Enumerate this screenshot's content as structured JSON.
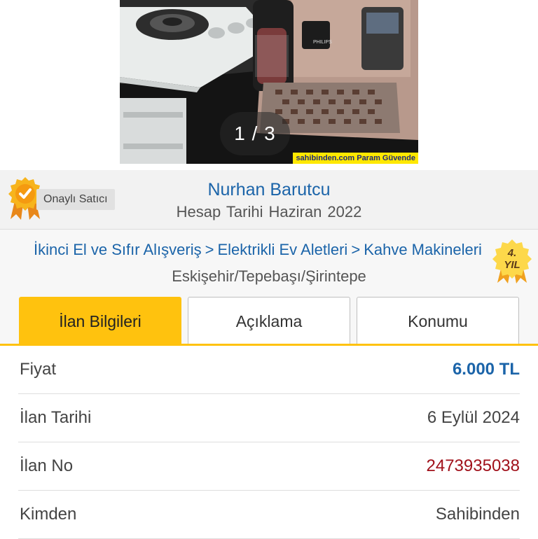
{
  "gallery": {
    "counter": "1 / 3",
    "watermark": "sahibinden.com Param Güvende"
  },
  "seller": {
    "badge_label": "Onaylı Satıcı",
    "name": "Nurhan Barutcu",
    "account_date_label": "Hesap Tarihi",
    "account_date_value": "Haziran 2022"
  },
  "category": {
    "breadcrumbs": [
      "İkinci El ve Sıfır Alışveriş",
      "Elektrikli Ev Aletleri",
      "Kahve Makineleri"
    ],
    "separator": ">",
    "location": "Eskişehir/Tepebaşı/Şirintepe",
    "year_badge": {
      "number": "4.",
      "word": "YIL"
    }
  },
  "tabs": [
    {
      "label": "İlan Bilgileri",
      "active": true
    },
    {
      "label": "Açıklama",
      "active": false
    },
    {
      "label": "Konumu",
      "active": false
    }
  ],
  "details": [
    {
      "key": "Fiyat",
      "value": "6.000 TL"
    },
    {
      "key": "İlan Tarihi",
      "value": "6 Eylül 2024"
    },
    {
      "key": "İlan No",
      "value": "2473935038"
    },
    {
      "key": "Kimden",
      "value": "Sahibinden"
    }
  ],
  "colors": {
    "accent_yellow": "#ffc20e",
    "link_blue": "#1b64a9",
    "ad_no_red": "#a0101a",
    "badge_orange": "#f7a51c"
  },
  "icons": [
    "verified-seller-badge-icon",
    "year-ribbon-icon"
  ]
}
